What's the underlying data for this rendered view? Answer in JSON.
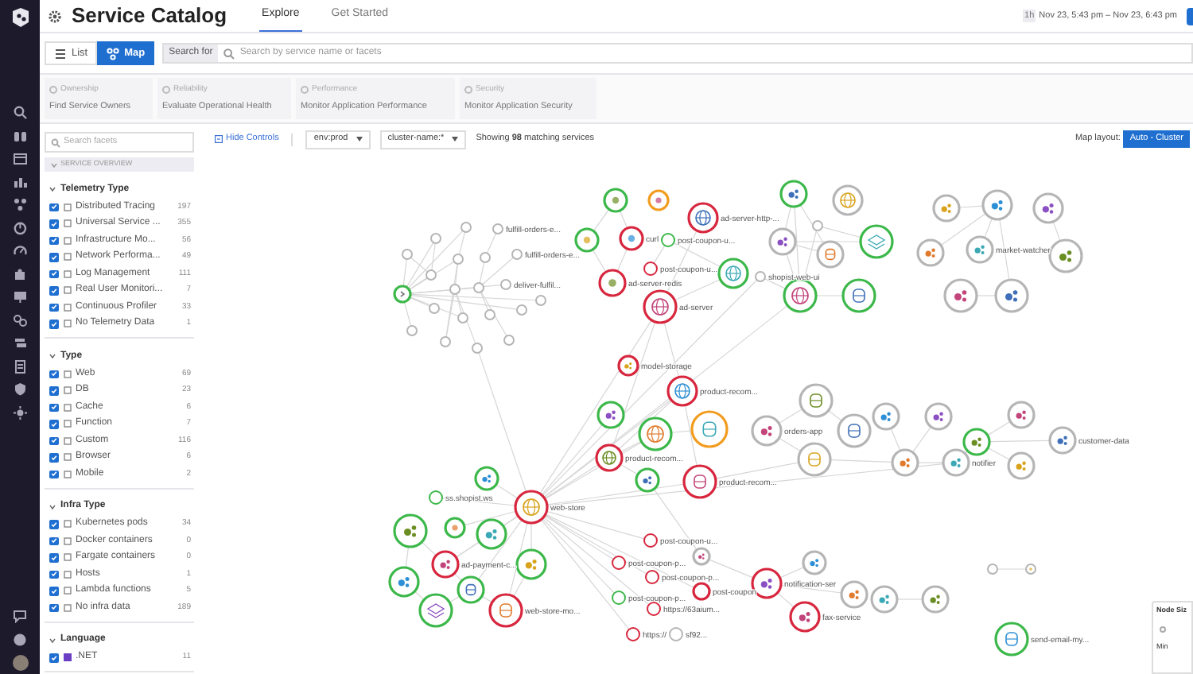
{
  "header": {
    "title": "Service Catalog",
    "tabs": [
      {
        "label": "Explore",
        "selected": true
      },
      {
        "label": "Get Started",
        "selected": false
      }
    ],
    "time_badge": "1h",
    "time_range": "Nov 23, 5:43 pm – Nov 23, 6:43 pm"
  },
  "view_toggle": [
    {
      "label": "List",
      "selected": false
    },
    {
      "label": "Map",
      "selected": true
    }
  ],
  "search": {
    "label": "Search for",
    "placeholder": "Search by service name or facets"
  },
  "cards": [
    {
      "title": "Ownership",
      "subtitle": "Find Service Owners"
    },
    {
      "title": "Reliability",
      "subtitle": "Evaluate Operational Health"
    },
    {
      "title": "Performance",
      "subtitle": "Monitor Application Performance"
    },
    {
      "title": "Security",
      "subtitle": "Monitor Application Security"
    }
  ],
  "controls": {
    "facet_search_placeholder": "Search facets",
    "hide_controls": "Hide Controls",
    "filters": [
      "env:prod",
      "cluster-name:*"
    ],
    "summary": "Showing **98** matching services",
    "layout_label": "Map layout:",
    "layout_button": "Auto - Cluster"
  },
  "facets": {
    "header": "SERVICE OVERVIEW",
    "sections": [
      {
        "title": "Telemetry Type",
        "items": [
          {
            "label": "Distributed Tracing",
            "count": "197",
            "checked": true
          },
          {
            "label": "Universal Service ...",
            "count": "355",
            "checked": true
          },
          {
            "label": "Infrastructure Mo...",
            "count": "56",
            "checked": true
          },
          {
            "label": "Network Performa...",
            "count": "49",
            "checked": true
          },
          {
            "label": "Log Management",
            "count": "111",
            "checked": true
          },
          {
            "label": "Real User Monitori...",
            "count": "7",
            "checked": true
          },
          {
            "label": "Continuous Profiler",
            "count": "33",
            "checked": true
          },
          {
            "label": "No Telemetry Data",
            "count": "1",
            "checked": true
          }
        ]
      },
      {
        "title": "Type",
        "items": [
          {
            "label": "Web",
            "count": "69",
            "checked": true
          },
          {
            "label": "DB",
            "count": "23",
            "checked": true
          },
          {
            "label": "Cache",
            "count": "6",
            "checked": true
          },
          {
            "label": "Function",
            "count": "7",
            "checked": true
          },
          {
            "label": "Custom",
            "count": "116",
            "checked": true
          },
          {
            "label": "Browser",
            "count": "6",
            "checked": true
          },
          {
            "label": "Mobile",
            "count": "2",
            "checked": true
          }
        ]
      },
      {
        "title": "Infra Type",
        "items": [
          {
            "label": "Kubernetes pods",
            "count": "34",
            "checked": true
          },
          {
            "label": "Docker containers",
            "count": "0",
            "checked": true
          },
          {
            "label": "Fargate containers",
            "count": "0",
            "checked": true
          },
          {
            "label": "Hosts",
            "count": "1",
            "checked": true
          },
          {
            "label": "Lambda functions",
            "count": "5",
            "checked": true
          },
          {
            "label": "No infra data",
            "count": "189",
            "checked": true
          }
        ]
      },
      {
        "title": "Language",
        "items": [
          {
            "label": ".NET",
            "count": "11",
            "checked": true
          }
        ]
      }
    ]
  },
  "map": {
    "nodes": [
      {
        "kind": "function",
        "color": "#3cb84a"
      },
      {
        "kind": "none",
        "color": "#b5b5b5"
      },
      {
        "kind": "none",
        "color": "#b5b5b5",
        "label": "fulfill-orders-e..."
      },
      {
        "kind": "none",
        "color": "#b5b5b5"
      },
      {
        "kind": "none",
        "color": "#b5b5b5",
        "label": "fulfill-orders-e..."
      },
      {
        "kind": "none",
        "color": "#b5b5b5"
      },
      {
        "kind": "none",
        "color": "#b5b5b5"
      },
      {
        "kind": "none",
        "color": "#b5b5b5"
      },
      {
        "kind": "none",
        "color": "#b5b5b5"
      },
      {
        "kind": "none",
        "color": "#b5b5b5"
      },
      {
        "kind": "none",
        "color": "#b5b5b5"
      },
      {
        "kind": "none",
        "color": "#b5b5b5",
        "label": "deliver-fulfil..."
      },
      {
        "kind": "none",
        "color": "#b5b5b5"
      },
      {
        "kind": "none",
        "color": "#b5b5b5"
      },
      {
        "kind": "none",
        "color": "#b5b5b5"
      },
      {
        "kind": "none",
        "color": "#b5b5b5"
      },
      {
        "kind": "none",
        "color": "#b5b5b5"
      },
      {
        "kind": "none",
        "color": "#b5b5b5"
      },
      {
        "kind": "none",
        "color": "#b5b5b5"
      },
      {
        "kind": "none",
        "color": "#b5b5b5"
      },
      {
        "kind": "none",
        "color": "#b5b5b5"
      },
      {
        "kind": "cache",
        "color": "#3cb84a"
      },
      {
        "kind": "cache",
        "color": "#f29c1f"
      },
      {
        "kind": "web",
        "color": "#d7263d",
        "label": "ad-server-http-..."
      },
      {
        "kind": "cache",
        "color": "#3cb84a"
      },
      {
        "kind": "cache",
        "color": "#d7263d",
        "label": "curl"
      },
      {
        "kind": "none",
        "color": "#3cb84a",
        "label": "post-coupon-u..."
      },
      {
        "kind": "none",
        "color": "#d7263d",
        "label": "post-coupon-u..."
      },
      {
        "kind": "web",
        "color": "#3cb84a"
      },
      {
        "kind": "cache",
        "color": "#d7263d",
        "label": "ad-server-redis"
      },
      {
        "kind": "web",
        "color": "#d7263d",
        "label": "ad-server"
      },
      {
        "kind": "custom",
        "color": "#3cb84a"
      },
      {
        "kind": "web",
        "color": "#b5b5b5"
      },
      {
        "kind": "none",
        "color": "#b5b5b5"
      },
      {
        "kind": "custom",
        "color": "#b5b5b5"
      },
      {
        "kind": "db",
        "color": "#b5b5b5"
      },
      {
        "kind": "layers",
        "color": "#3cb84a"
      },
      {
        "kind": "none",
        "color": "#b5b5b5",
        "label": "shopist-web-ui"
      },
      {
        "kind": "web",
        "color": "#3cb84a"
      },
      {
        "kind": "db",
        "color": "#3cb84a"
      },
      {
        "kind": "custom",
        "color": "#b5b5b5"
      },
      {
        "kind": "custom",
        "color": "#b5b5b5"
      },
      {
        "kind": "custom",
        "color": "#b5b5b5"
      },
      {
        "kind": "custom",
        "color": "#b5b5b5"
      },
      {
        "kind": "custom",
        "color": "#b5b5b5",
        "label": "market-watcher"
      },
      {
        "kind": "custom",
        "color": "#b5b5b5"
      },
      {
        "kind": "custom",
        "color": "#b5b5b5"
      },
      {
        "kind": "custom",
        "color": "#b5b5b5"
      },
      {
        "kind": "custom",
        "color": "#d7263d",
        "label": "model-storage"
      },
      {
        "kind": "web",
        "color": "#d7263d",
        "label": "product-recom..."
      },
      {
        "kind": "custom",
        "color": "#3cb84a"
      },
      {
        "kind": "web",
        "color": "#3cb84a"
      },
      {
        "kind": "db",
        "color": "#f29c1f"
      },
      {
        "kind": "web",
        "color": "#d7263d",
        "label": "product-recom..."
      },
      {
        "kind": "db",
        "color": "#d7263d",
        "label": "product-recom..."
      },
      {
        "kind": "custom",
        "color": "#3cb84a"
      },
      {
        "kind": "web",
        "color": "#d7263d",
        "label": "web-store"
      },
      {
        "kind": "custom",
        "color": "#3cb84a"
      },
      {
        "kind": "none",
        "color": "#3cb84a",
        "label": "ss.shopist.ws"
      },
      {
        "kind": "cache",
        "color": "#3cb84a"
      },
      {
        "kind": "custom",
        "color": "#3cb84a"
      },
      {
        "kind": "custom",
        "color": "#3cb84a"
      },
      {
        "kind": "custom",
        "color": "#d7263d",
        "label": "ad-payment-c..."
      },
      {
        "kind": "db",
        "color": "#3cb84a"
      },
      {
        "kind": "custom",
        "color": "#3cb84a"
      },
      {
        "kind": "custom",
        "color": "#3cb84a"
      },
      {
        "kind": "layers",
        "color": "#3cb84a"
      },
      {
        "kind": "db",
        "color": "#d7263d",
        "label": "web-store-mo..."
      },
      {
        "kind": "none",
        "color": "#d7263d",
        "label": "post-coupon-u..."
      },
      {
        "kind": "none",
        "color": "#d7263d",
        "label": "post-coupon-p..."
      },
      {
        "kind": "custom",
        "color": "#b5b5b5"
      },
      {
        "kind": "none",
        "color": "#d7263d",
        "label": "post-coupon-p..."
      },
      {
        "kind": "none",
        "color": "#3cb84a",
        "label": "post-coupon-p..."
      },
      {
        "kind": "none",
        "color": "#d7263d",
        "label": "post-coupon"
      },
      {
        "kind": "none",
        "color": "#d7263d",
        "label": "https://63aium..."
      },
      {
        "kind": "none",
        "color": "#d7263d",
        "label": "https://"
      },
      {
        "kind": "none",
        "color": "#b5b5b5",
        "label": "sf92..."
      },
      {
        "kind": "db",
        "color": "#b5b5b5"
      },
      {
        "kind": "custom",
        "color": "#b5b5b5",
        "label": "orders-app"
      },
      {
        "kind": "db",
        "color": "#b5b5b5"
      },
      {
        "kind": "db",
        "color": "#b5b5b5"
      },
      {
        "kind": "custom",
        "color": "#b5b5b5"
      },
      {
        "kind": "custom",
        "color": "#b5b5b5"
      },
      {
        "kind": "custom",
        "color": "#b5b5b5"
      },
      {
        "kind": "custom",
        "color": "#b5b5b5",
        "label": "notifier"
      },
      {
        "kind": "custom",
        "color": "#3cb84a"
      },
      {
        "kind": "custom",
        "color": "#b5b5b5"
      },
      {
        "kind": "custom",
        "color": "#b5b5b5",
        "label": "customer-data"
      },
      {
        "kind": "custom",
        "color": "#b5b5b5"
      },
      {
        "kind": "custom",
        "color": "#b5b5b5"
      },
      {
        "kind": "custom",
        "color": "#d7263d",
        "label": "notification-ser"
      },
      {
        "kind": "custom",
        "color": "#b5b5b5"
      },
      {
        "kind": "custom",
        "color": "#b5b5b5"
      },
      {
        "kind": "custom",
        "color": "#b5b5b5"
      },
      {
        "kind": "custom",
        "color": "#d7263d",
        "label": "fax-service"
      },
      {
        "kind": "none",
        "color": "#b5b5b5"
      },
      {
        "kind": "cache",
        "color": "#b5b5b5"
      },
      {
        "kind": "db",
        "color": "#3cb84a",
        "label": "send-email-my..."
      }
    ],
    "legend": {
      "title": "Node Siz",
      "min_label": "Min"
    }
  }
}
